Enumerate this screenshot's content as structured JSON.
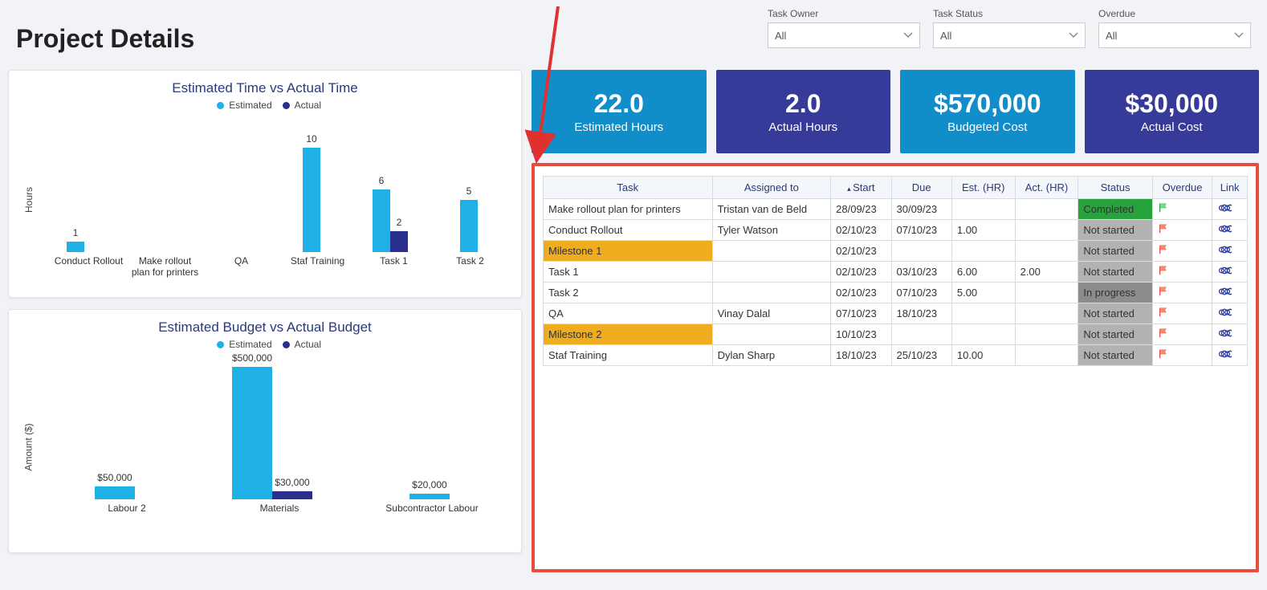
{
  "page_title": "Project Details",
  "filters": {
    "owner": {
      "label": "Task Owner",
      "value": "All"
    },
    "status": {
      "label": "Task Status",
      "value": "All"
    },
    "overdue": {
      "label": "Overdue",
      "value": "All"
    }
  },
  "kpi": {
    "est_hours": {
      "value": "22.0",
      "label": "Estimated Hours"
    },
    "act_hours": {
      "value": "2.0",
      "label": "Actual Hours"
    },
    "budget": {
      "value": "$570,000",
      "label": "Budgeted Cost"
    },
    "actual_cost": {
      "value": "$30,000",
      "label": "Actual Cost"
    }
  },
  "chart_data": [
    {
      "type": "bar",
      "title": "Estimated Time vs Actual Time",
      "ylabel": "Hours",
      "legend": {
        "series1": "Estimated",
        "series2": "Actual"
      },
      "categories": [
        "Conduct Rollout",
        "Make rollout plan for printers",
        "QA",
        "Staf Training",
        "Task 1",
        "Task 2"
      ],
      "series": [
        {
          "name": "Estimated",
          "values": [
            1,
            null,
            null,
            10,
            6,
            5
          ]
        },
        {
          "name": "Actual",
          "values": [
            null,
            null,
            null,
            null,
            2,
            null
          ]
        }
      ],
      "ylim": [
        0,
        10
      ],
      "colors": {
        "Estimated": "#1eb0e6",
        "Actual": "#2a2f8e"
      }
    },
    {
      "type": "bar",
      "title": "Estimated Budget vs Actual Budget",
      "ylabel": "Amount ($)",
      "legend": {
        "series1": "Estimated",
        "series2": "Actual"
      },
      "categories": [
        "Labour 2",
        "Materials",
        "Subcontractor Labour"
      ],
      "series": [
        {
          "name": "Estimated",
          "values": [
            50000,
            500000,
            20000
          ],
          "labels": [
            "$50,000",
            "$500,000",
            "$20,000"
          ]
        },
        {
          "name": "Actual",
          "values": [
            null,
            30000,
            null
          ],
          "labels": [
            null,
            "$30,000",
            null
          ]
        }
      ],
      "ylim": [
        0,
        500000
      ],
      "colors": {
        "Estimated": "#1eb0e6",
        "Actual": "#2a2f8e"
      }
    }
  ],
  "table": {
    "headers": {
      "task": "Task",
      "assigned": "Assigned to",
      "start": "Start",
      "due": "Due",
      "est": "Est. (HR)",
      "act": "Act. (HR)",
      "status": "Status",
      "overdue": "Overdue",
      "link": "Link"
    },
    "rows": [
      {
        "task": "Make rollout plan for printers",
        "assigned": "Tristan van de Beld",
        "start": "28/09/23",
        "due": "30/09/23",
        "est": "",
        "act": "",
        "status": "Completed",
        "status_class": "completed",
        "flag": "green",
        "milestone": false
      },
      {
        "task": "Conduct Rollout",
        "assigned": "Tyler Watson",
        "start": "02/10/23",
        "due": "07/10/23",
        "est": "1.00",
        "act": "",
        "status": "Not started",
        "status_class": "notstarted",
        "flag": "red",
        "milestone": false
      },
      {
        "task": "Milestone 1",
        "assigned": "",
        "start": "02/10/23",
        "due": "",
        "est": "",
        "act": "",
        "status": "Not started",
        "status_class": "notstarted",
        "flag": "red",
        "milestone": true
      },
      {
        "task": "Task 1",
        "assigned": "",
        "start": "02/10/23",
        "due": "03/10/23",
        "est": "6.00",
        "act": "2.00",
        "status": "Not started",
        "status_class": "notstarted",
        "flag": "red",
        "milestone": false
      },
      {
        "task": "Task 2",
        "assigned": "",
        "start": "02/10/23",
        "due": "07/10/23",
        "est": "5.00",
        "act": "",
        "status": "In progress",
        "status_class": "inprogress",
        "flag": "red",
        "milestone": false
      },
      {
        "task": "QA",
        "assigned": "Vinay Dalal",
        "start": "07/10/23",
        "due": "18/10/23",
        "est": "",
        "act": "",
        "status": "Not started",
        "status_class": "notstarted",
        "flag": "red",
        "milestone": false
      },
      {
        "task": "Milestone 2",
        "assigned": "",
        "start": "10/10/23",
        "due": "",
        "est": "",
        "act": "",
        "status": "Not started",
        "status_class": "notstarted",
        "flag": "red",
        "milestone": true
      },
      {
        "task": "Staf Training",
        "assigned": "Dylan Sharp",
        "start": "18/10/23",
        "due": "25/10/23",
        "est": "10.00",
        "act": "",
        "status": "Not started",
        "status_class": "notstarted",
        "flag": "red",
        "milestone": false
      }
    ]
  }
}
